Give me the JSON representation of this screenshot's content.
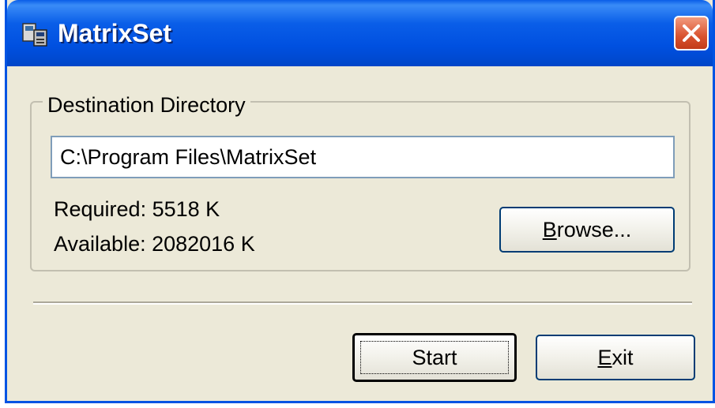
{
  "window": {
    "title": "MatrixSet"
  },
  "icons": {
    "app": "setup-icon",
    "close": "close-icon"
  },
  "group": {
    "label": "Destination Directory"
  },
  "path_field": {
    "value": "C:\\Program Files\\MatrixSet"
  },
  "info": {
    "required": "Required: 5518 K",
    "available": "Available: 2082016 K"
  },
  "buttons": {
    "browse": {
      "accel": "B",
      "rest": "rowse..."
    },
    "start": {
      "label": "Start"
    },
    "exit": {
      "accel": "E",
      "rest": "xit"
    }
  },
  "colors": {
    "titlebar": "#0054e3",
    "dialog_bg": "#ece9d8",
    "close_button": "#d9532f"
  }
}
